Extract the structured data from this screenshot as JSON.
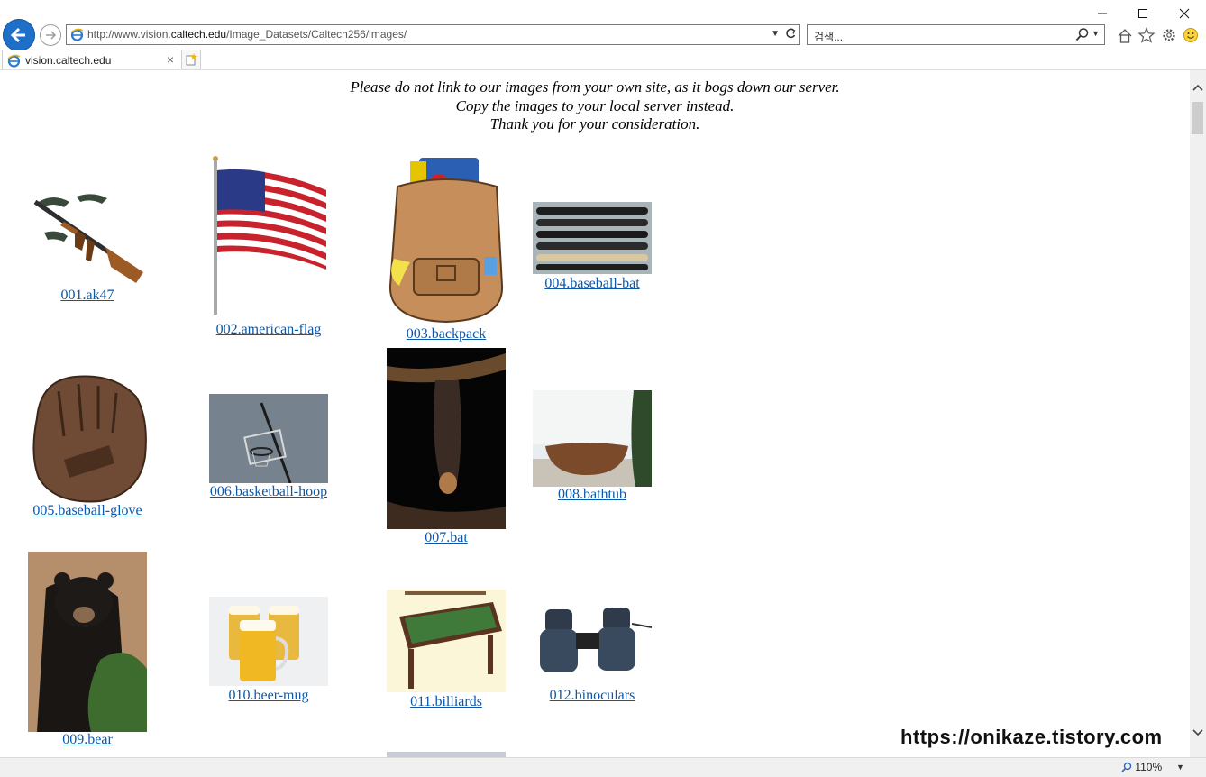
{
  "browser": {
    "address_url_prefix": "http://www.vision.",
    "address_url_domain": "caltech.edu",
    "address_url_path": "/Image_Datasets/Caltech256/images/",
    "search_placeholder": "검색...",
    "tab_title": "vision.caltech.edu",
    "zoom": "110%"
  },
  "page": {
    "notice_lines": [
      "Please do not link to our images from your own site, as it bogs down our server.",
      "Copy the images to your local server instead.",
      "Thank you for your consideration."
    ],
    "categories": [
      "001.ak47",
      "002.american-flag",
      "003.backpack",
      "004.baseball-bat",
      "005.baseball-glove",
      "006.basketball-hoop",
      "007.bat",
      "008.bathtub",
      "009.bear",
      "010.beer-mug",
      "011.billiards",
      "012.binoculars"
    ]
  },
  "watermark": "https://onikaze.tistory.com",
  "colors": {
    "link": "#0b57a9",
    "back_button": "#1e6fc8"
  }
}
